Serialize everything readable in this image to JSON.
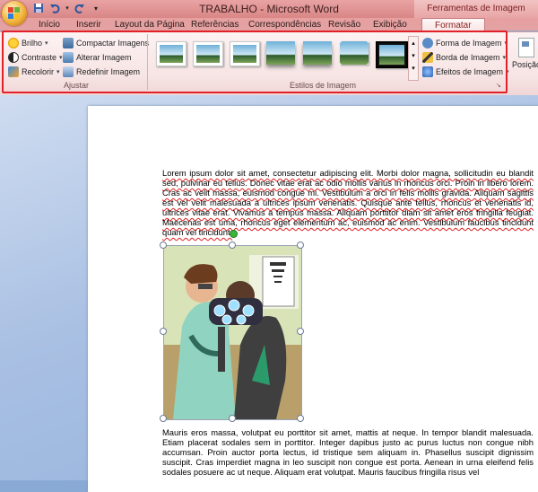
{
  "window": {
    "title": "TRABALHO - Microsoft Word",
    "context_tab_group": "Ferramentas de Imagem"
  },
  "quick_access": [
    "save-icon",
    "undo-icon",
    "redo-icon",
    "customize-icon"
  ],
  "tabs": [
    "Início",
    "Inserir",
    "Layout da Página",
    "Referências",
    "Correspondências",
    "Revisão",
    "Exibição",
    "Formatar"
  ],
  "active_tab": "Formatar",
  "ribbon": {
    "ajustar": {
      "label": "Ajustar",
      "buttons": [
        "Brilho",
        "Contraste",
        "Recolorir",
        "Compactar Imagens",
        "Alterar Imagem",
        "Redefinir Imagem"
      ]
    },
    "estilos": {
      "label": "Estilos de Imagem",
      "buttons": [
        "Forma de Imagem",
        "Borda de Imagem",
        "Efeitos de Imagem"
      ]
    },
    "organizar": {
      "buttons": [
        "Posição"
      ]
    }
  },
  "colors": {
    "title_bar": "#d98686",
    "ribbon_bg": "#f7e4e4",
    "highlight": "#e1202a",
    "doc_bg": "#a9c0e3"
  },
  "document": {
    "para1": "Lorem ipsum dolor sit amet, consectetur adipiscing elit. Morbi dolor magna, sollicitudin eu blandit sed, pulvinar eu tellus. Donec vitae erat ac odio mollis varius in rhoncus orci. Proin in libero lorem. Cras ac velit massa, euismod congue mi. Vestibulum a orci in felis mollis gravida. Aliquam sagittis est vel velit malesuada a ultrices ipsum venenatis. Quisque ante tellus, rhoncus et venenatis id, ultrices vitae erat. Vivamus a tempus massa. Aliquam porttitor diam sit amet eros fringilla feugiat. Maecenas est uma, rhoncus eget elementum ac, euismod ac enim. Vestibulum faucibus tincidunt quam vel tincidunt.",
    "para2": "Mauris eros massa, volutpat eu porttitor sit amet, mattis at neque. In tempor blandit malesuada. Etiam placerat sodales sem in porttitor. Integer dapibus justo ac purus luctus non congue nibh accumsan. Proin auctor porta lectus, id tristique sem aliquam in. Phasellus suscipit dignissim suscipit. Cras imperdiet magna in leo suscipit non congue est porta. Aenean in urna eleifend felis sodales posuere ac ut neque. Aliquam erat volutpat. Mauris faucibus fringilla risus vel"
  }
}
